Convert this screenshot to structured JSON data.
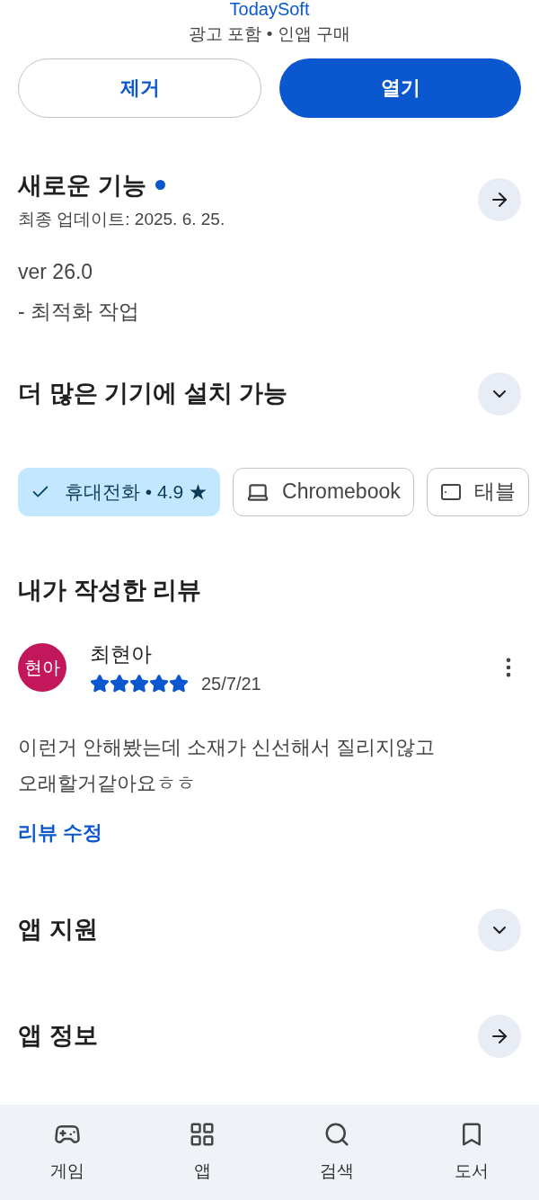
{
  "header": {
    "developer": "TodaySoft",
    "tags": "광고 포함 • 인앱 구매"
  },
  "actions": [
    {
      "label": "제거",
      "kind": "outline"
    },
    {
      "label": "열기",
      "kind": "filled"
    }
  ],
  "whats_new": {
    "title": "새로운 기능",
    "new_dot": true,
    "updated": "최종 업데이트: 2025. 6. 25.",
    "lines": [
      "ver 26.0",
      "- 최적화 작업"
    ]
  },
  "devices": {
    "title": "더 많은 기기에 설치 가능",
    "expanded": false,
    "chips": [
      {
        "label": "휴대전화 • 4.9 ★",
        "selected": true
      },
      {
        "label": "Chromebook",
        "kind": "laptop",
        "selected": false
      },
      {
        "label": "태블",
        "kind": "tablet",
        "selected": false
      }
    ]
  },
  "review": {
    "title": "내가 작성한 리뷰",
    "avatar": "현아",
    "author": "최현아",
    "stars": 5,
    "date": "25/7/21",
    "text": "이런거 안해봤는데 소재가 신선해서 질리지않고 오래할거같아요ㅎㅎ",
    "edit": "리뷰 수정"
  },
  "sections": [
    {
      "title": "앱 지원",
      "kind": "expand"
    },
    {
      "title": "앱 정보",
      "kind": "arrow"
    }
  ],
  "nav": [
    {
      "label": "게임",
      "kind": "games"
    },
    {
      "label": "앱",
      "kind": "apps"
    },
    {
      "label": "검색",
      "kind": "search"
    },
    {
      "label": "도서",
      "kind": "books"
    }
  ]
}
